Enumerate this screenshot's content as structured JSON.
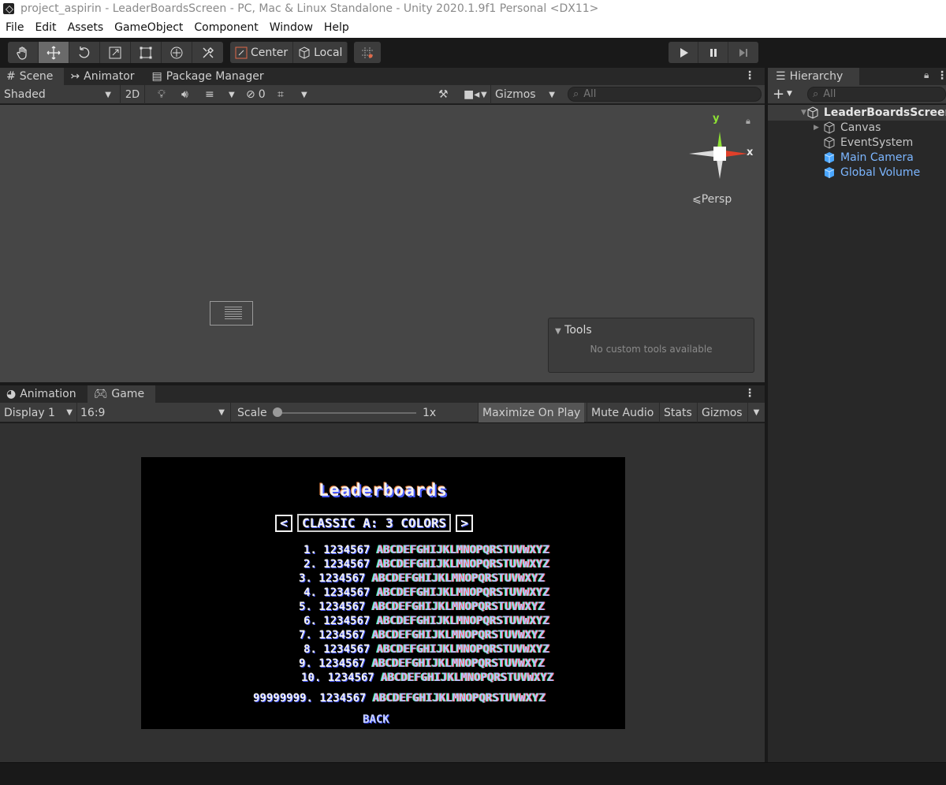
{
  "window": {
    "title": "project_aspirin - LeaderBoardsScreen - PC, Mac & Linux Standalone - Unity 2020.1.9f1 Personal <DX11>"
  },
  "menu": [
    "File",
    "Edit",
    "Assets",
    "GameObject",
    "Component",
    "Window",
    "Help"
  ],
  "toolbar": {
    "tools": [
      "hand-tool-icon",
      "move-tool-icon",
      "rotate-tool-icon",
      "scale-tool-icon",
      "rect-tool-icon",
      "transform-tool-icon",
      "custom-tool-icon"
    ],
    "pivot_label": "Center",
    "space_label": "Local"
  },
  "scene": {
    "tabs": [
      "Scene",
      "Animator",
      "Package Manager"
    ],
    "shading_mode": "Shaded",
    "mode_2d": "2D",
    "hidden_count": "0",
    "gizmos_label": "Gizmos",
    "search_placeholder": "All",
    "persp_label": "Persp",
    "axis_x": "x",
    "axis_y": "y",
    "tools_panel": {
      "title": "Tools",
      "message": "No custom tools available"
    }
  },
  "game": {
    "tabs": [
      "Animation",
      "Game"
    ],
    "display": "Display 1",
    "aspect": "16:9",
    "scale_label": "Scale",
    "scale_value": "1x",
    "maximize_label": "Maximize On Play",
    "mute_label": "Mute Audio",
    "stats_label": "Stats",
    "gizmos_label": "Gizmos",
    "screen": {
      "title": "Leaderboards",
      "mode": "CLASSIC A: 3 COLORS",
      "rows": [
        {
          "rank": "1.",
          "score": "1234567",
          "name": "ABCDEFGHIJKLMNOPQRSTUVWXYZ"
        },
        {
          "rank": "2.",
          "score": "1234567",
          "name": "ABCDEFGHIJKLMNOPQRSTUVWXYZ"
        },
        {
          "rank": "3.",
          "score": "1234567",
          "name": "ABCDEFGHIJKLMNOPQRSTUVWXYZ"
        },
        {
          "rank": "4.",
          "score": "1234567",
          "name": "ABCDEFGHIJKLMNOPQRSTUVWXYZ"
        },
        {
          "rank": "5.",
          "score": "1234567",
          "name": "ABCDEFGHIJKLMNOPQRSTUVWXYZ"
        },
        {
          "rank": "6.",
          "score": "1234567",
          "name": "ABCDEFGHIJKLMNOPQRSTUVWXYZ"
        },
        {
          "rank": "7.",
          "score": "1234567",
          "name": "ABCDEFGHIJKLMNOPQRSTUVWXYZ"
        },
        {
          "rank": "8.",
          "score": "1234567",
          "name": "ABCDEFGHIJKLMNOPQRSTUVWXYZ"
        },
        {
          "rank": "9.",
          "score": "1234567",
          "name": "ABCDEFGHIJKLMNOPQRSTUVWXYZ"
        },
        {
          "rank": "10.",
          "score": "1234567",
          "name": "ABCDEFGHIJKLMNOPQRSTUVWXYZ"
        }
      ],
      "player_row": {
        "rank": "99999999.",
        "score": "1234567",
        "name": "ABCDEFGHIJKLMNOPQRSTUVWXYZ"
      },
      "back_label": "BACK"
    }
  },
  "hierarchy": {
    "tab": "Hierarchy",
    "search_placeholder": "All",
    "scene_name": "LeaderBoardsScreen",
    "items": [
      {
        "label": "Canvas",
        "prefab": false,
        "expandable": true
      },
      {
        "label": "EventSystem",
        "prefab": false,
        "expandable": false
      },
      {
        "label": "Main Camera",
        "prefab": true,
        "expandable": false
      },
      {
        "label": "Global Volume",
        "prefab": true,
        "expandable": false
      }
    ]
  },
  "colors": {
    "editor_bg": "#191919",
    "panel": "#3c3c3c",
    "scene_bg": "#464646",
    "prefab_blue": "#7cb6ff",
    "gizmo_x": "#e0402a",
    "gizmo_y": "#8ee234"
  }
}
